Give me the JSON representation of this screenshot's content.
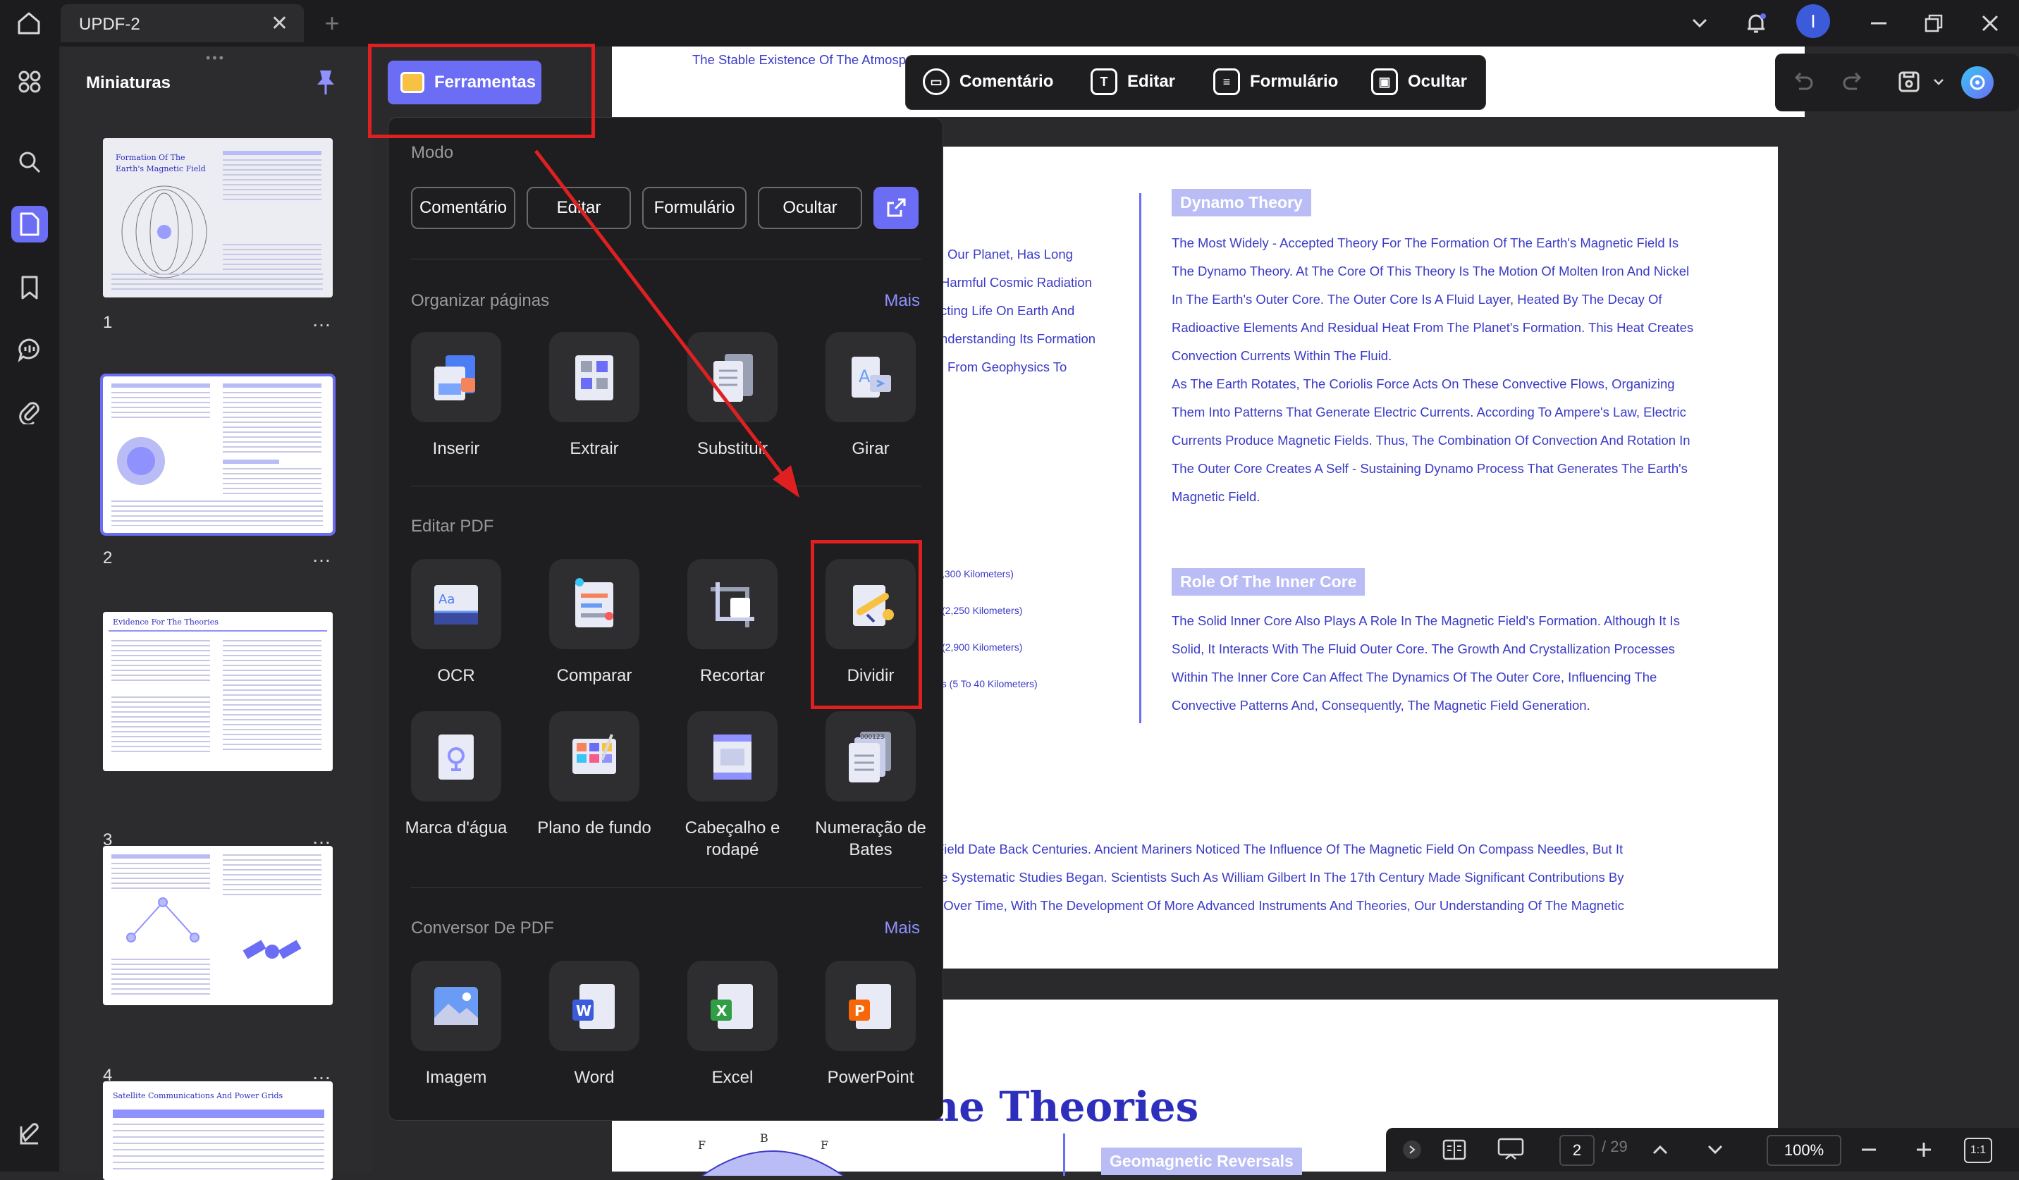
{
  "titlebar": {
    "tab_title": "UPDF-2",
    "close_glyph": "✕",
    "newtab_glyph": "+",
    "avatar_letter": "I"
  },
  "thumbnails": {
    "title": "Miniaturas",
    "pages": [
      {
        "num": "1",
        "heading": "Formation Of The Earth's Magnetic Field"
      },
      {
        "num": "2",
        "heading": ""
      },
      {
        "num": "3",
        "heading": "Evidence For The Theories"
      },
      {
        "num": "4",
        "heading": ""
      },
      {
        "num": "",
        "heading": "Satellite Communications And Power Grids"
      }
    ],
    "more_glyph": "…"
  },
  "floatbar": {
    "comment": "Comentário",
    "edit": "Editar",
    "form": "Formulário",
    "hide": "Ocultar"
  },
  "tools_button": "Ferramentas",
  "menu": {
    "mode_title": "Modo",
    "modes": [
      "Comentário",
      "Editar",
      "Formulário",
      "Ocultar"
    ],
    "organize_title": "Organizar páginas",
    "organize_more": "Mais",
    "organize": [
      "Inserir",
      "Extrair",
      "Substituir",
      "Girar"
    ],
    "edit_title": "Editar PDF",
    "edit_row1": [
      "OCR",
      "Comparar",
      "Recortar",
      "Dividir"
    ],
    "edit_row2": [
      "Marca d'água",
      "Plano de fundo",
      "Cabeçalho e rodapé",
      "Numeração de Bates"
    ],
    "convert_title": "Conversor De PDF",
    "convert_more": "Mais",
    "convert": [
      "Imagem",
      "Word",
      "Excel",
      "PowerPoint"
    ]
  },
  "document": {
    "top_line": "The Stable Existence Of The Atmosp",
    "left_lines": [
      "Our Planet, Has Long",
      "Harmful Cosmic Radiation",
      "cting Life On Earth And",
      "nderstanding Its Formation",
      "From Geophysics To"
    ],
    "dynamo_heading": "Dynamo Theory",
    "dynamo_lines": [
      "The Most Widely - Accepted Theory For The Formation Of The Earth's Magnetic Field Is",
      "The Dynamo Theory. At The Core Of This Theory Is The Motion Of Molten Iron And Nickel",
      "In The Earth's Outer Core. The Outer Core Is A Fluid Layer, Heated By The Decay Of",
      "Radioactive Elements And Residual Heat From The Planet's Formation. This Heat Creates",
      "Convection Currents Within The Fluid.",
      "As The Earth Rotates, The Coriolis Force Acts On These Convective Flows, Organizing",
      "Them Into Patterns That Generate Electric Currents. According To Ampere's Law, Electric",
      "Currents Produce Magnetic Fields. Thus, The Combination Of Convection And Rotation In",
      "The Outer Core Creates A Self - Sustaining Dynamo Process That Generates The Earth's",
      "Magnetic Field."
    ],
    "km_lines": [
      ",300 Kilometers)",
      "(2,250 Kilometers)",
      "(2,900 Kilometers)",
      "es (5 To 40 Kilometers)"
    ],
    "inner_heading": "Role Of The Inner Core",
    "inner_lines": [
      "The Solid Inner Core Also Plays A Role In The Magnetic Field's Formation. Although It Is",
      "Solid, It Interacts With The Fluid Outer Core. The Growth And Crystallization Processes",
      "Within The Inner Core Can Affect The Dynamics Of The Outer Core, Influencing The",
      "Convective Patterns And, Consequently, The Magnetic Field Generation."
    ],
    "bottom_lines": [
      "Field Date Back Centuries. Ancient Mariners Noticed The Influence Of The Magnetic Field On Compass Needles, But It",
      "re Systematic Studies Began. Scientists Such As William Gilbert In The 17th Century Made Significant Contributions By",
      ". Over Time, With The Development Of More Advanced Instruments And Theories, Our Understanding Of The Magnetic"
    ],
    "page2_heading": "ne Theories",
    "geomag_heading": "Geomagnetic Reversals"
  },
  "bottombar": {
    "page_current": "2",
    "page_total": "/ 29",
    "zoom": "100%",
    "fit": "1:1"
  },
  "colors": {
    "accent": "#6b6ef5",
    "annotation_red": "#e02020",
    "doc_text": "#3a3ac8"
  }
}
